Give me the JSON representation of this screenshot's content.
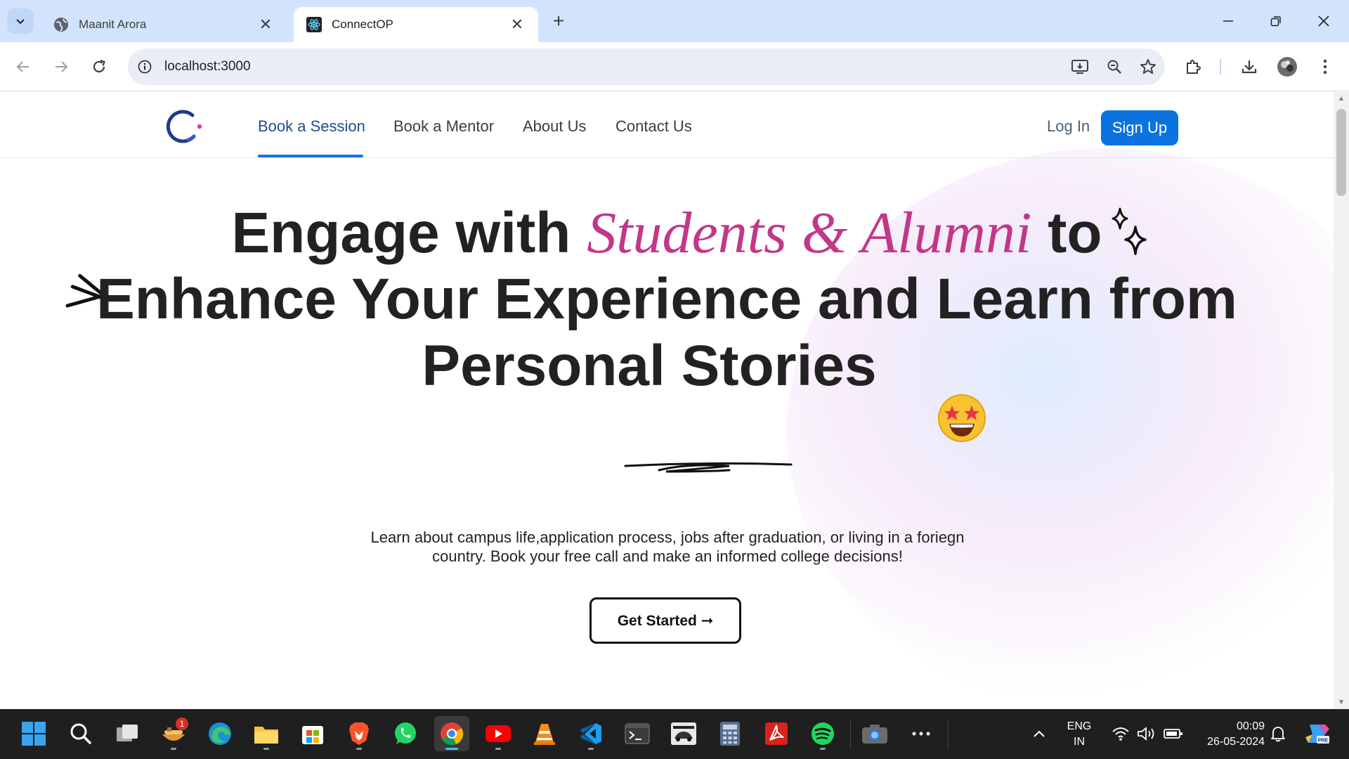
{
  "browser": {
    "tabs": [
      {
        "title": "Maanit Arora",
        "active": false,
        "favicon": "globe-icon"
      },
      {
        "title": "ConnectOP",
        "active": true,
        "favicon": "react-icon"
      }
    ],
    "url": "localhost:3000"
  },
  "site": {
    "nav": {
      "links": [
        "Book a Session",
        "Book a Mentor",
        "About Us",
        "Contact Us"
      ],
      "active_index": 0,
      "login": "Log In",
      "signup": "Sign Up"
    },
    "hero": {
      "line1_before": "Engage with",
      "line1_script": "Students & Alumni",
      "line1_after": "to",
      "line2": "Enhance Your Experience and Learn from",
      "line3": "Personal Stories",
      "emoji": "🤩",
      "subtext": "Learn about campus life,application process, jobs after graduation, or living in a foriegn country. Book your free call and make an informed college decisions!",
      "cta": "Get Started ➞"
    },
    "colors": {
      "accent": "#0a73e0",
      "script": "#c2378a",
      "nav_underline": "#1a73e8"
    }
  },
  "taskbar": {
    "apps": [
      "windows-start",
      "search",
      "task-view",
      "food-app",
      "edge",
      "file-explorer",
      "microsoft-store",
      "brave",
      "whatsapp",
      "chrome",
      "youtube",
      "vlc",
      "vscode",
      "terminal",
      "asphalt-game",
      "calculator",
      "acrobat",
      "spotify",
      "camera",
      "more"
    ],
    "notification_badge": "1",
    "language": "ENG",
    "region": "IN",
    "time": "00:09",
    "date": "26-05-2024"
  }
}
